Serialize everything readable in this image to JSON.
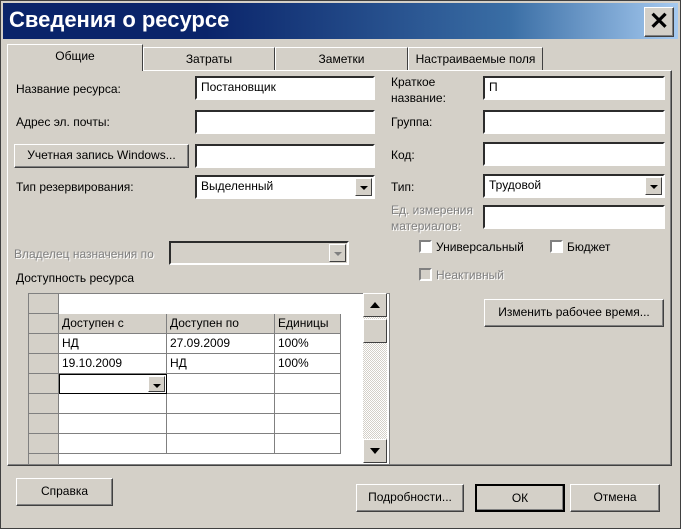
{
  "window": {
    "title": "Сведения о ресурсе",
    "close": "✕"
  },
  "tabs": [
    {
      "label": "Общие",
      "active": true
    },
    {
      "label": "Затраты",
      "active": false
    },
    {
      "label": "Заметки",
      "active": false
    },
    {
      "label": "Настраиваемые поля",
      "active": false
    }
  ],
  "left": {
    "name_label": "Название ресурса:",
    "name_value": "Постановщик",
    "email_label": "Адрес эл. почты:",
    "email_value": "",
    "windows_account_button": "Учетная запись Windows...",
    "windows_account_value": "",
    "booking_label": "Тип резервирования:",
    "booking_value": "Выделенный",
    "owner_label": "Владелец назначения по",
    "owner_value": "",
    "availability_label": "Доступность ресурса"
  },
  "right": {
    "short_name_label_1": "Краткое",
    "short_name_label_2": "название:",
    "short_name_value": "П",
    "group_label": "Группа:",
    "group_value": "",
    "code_label": "Код:",
    "code_value": "",
    "type_label": "Тип:",
    "type_value": "Трудовой",
    "unit_label_1": "Ед. измерения",
    "unit_label_2": "материалов:",
    "unit_value": "",
    "generic_label": "Универсальный",
    "budget_label": "Бюджет",
    "inactive_label": "Неактивный",
    "change_worktime_button": "Изменить рабочее время..."
  },
  "availability_table": {
    "columns": [
      "Доступен с",
      "Доступен по",
      "Единицы"
    ],
    "rows": [
      [
        "НД",
        "27.09.2009",
        "100%"
      ],
      [
        "19.10.2009",
        "НД",
        "100%"
      ]
    ]
  },
  "footer": {
    "help_button": "Справка",
    "details_button": "Подробности...",
    "ok_button": "ОК",
    "cancel_button": "Отмена"
  }
}
